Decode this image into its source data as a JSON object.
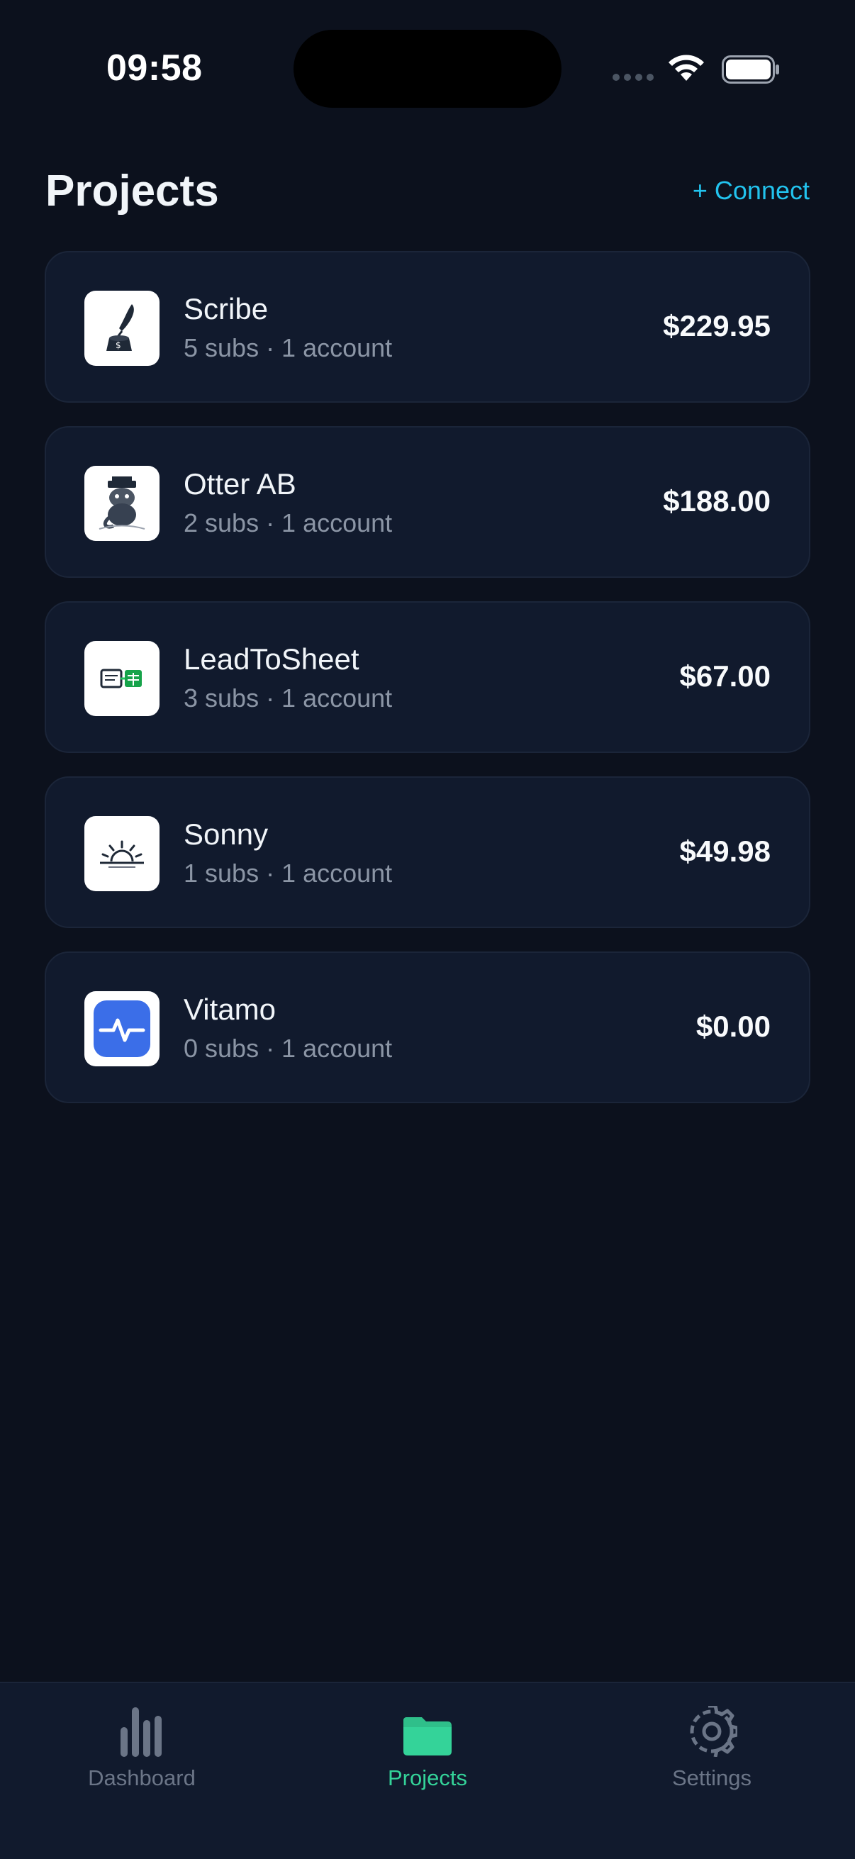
{
  "status_bar": {
    "time": "09:58"
  },
  "header": {
    "title": "Projects",
    "connect_label": "+ Connect"
  },
  "projects": [
    {
      "name": "Scribe",
      "meta": "5 subs · 1 account",
      "amount": "$229.95",
      "logo": "quill-ink-icon"
    },
    {
      "name": "Otter AB",
      "meta": "2 subs · 1 account",
      "amount": "$188.00",
      "logo": "otter-icon"
    },
    {
      "name": "LeadToSheet",
      "meta": "3 subs · 1 account",
      "amount": "$67.00",
      "logo": "sheet-icon"
    },
    {
      "name": "Sonny",
      "meta": "1 subs · 1 account",
      "amount": "$49.98",
      "logo": "sunrise-icon"
    },
    {
      "name": "Vitamo",
      "meta": "0 subs · 1 account",
      "amount": "$0.00",
      "logo": "pulse-icon"
    }
  ],
  "tab_bar": {
    "tabs": [
      {
        "label": "Dashboard",
        "icon": "bar-chart-icon",
        "active": false
      },
      {
        "label": "Projects",
        "icon": "folder-icon",
        "active": true
      },
      {
        "label": "Settings",
        "icon": "gear-icon",
        "active": false
      }
    ]
  },
  "colors": {
    "background": "#0c111d",
    "card": "#111a2d",
    "accent_link": "#22c3ee",
    "active_tab": "#34d399"
  }
}
